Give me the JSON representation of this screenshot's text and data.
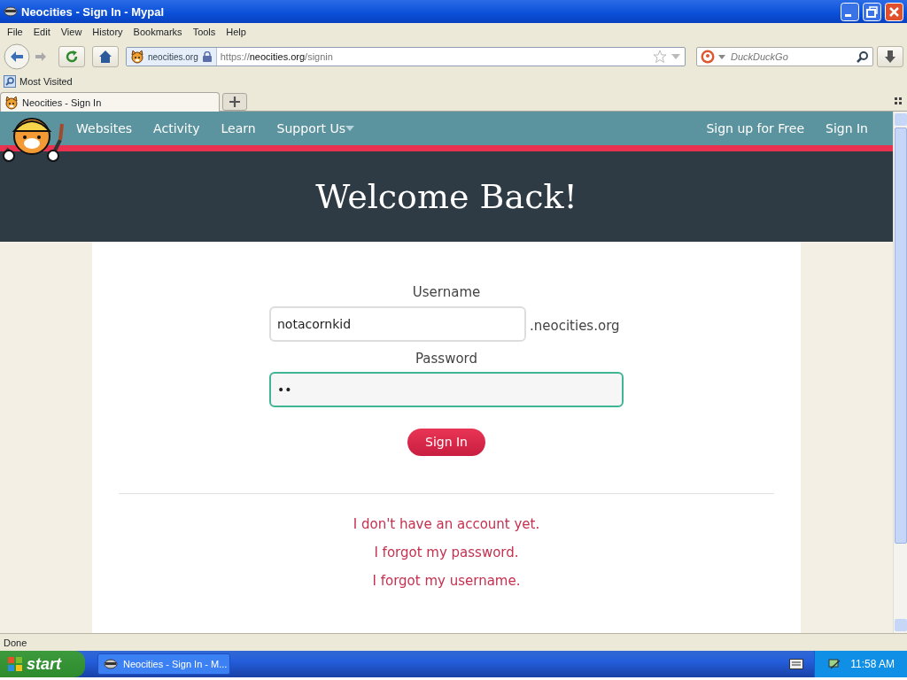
{
  "window": {
    "title": "Neocities - Sign In - Mypal"
  },
  "menu": [
    "File",
    "Edit",
    "View",
    "History",
    "Bookmarks",
    "Tools",
    "Help"
  ],
  "address_bar": {
    "identity": "neocities.org",
    "scheme": "https://",
    "host": "neocities.org",
    "path": "/signin"
  },
  "search": {
    "placeholder": "DuckDuckGo"
  },
  "bookmarks": [
    "Most Visited"
  ],
  "tabs": [
    {
      "label": "Neocities - Sign In",
      "selected": true
    }
  ],
  "site_nav": {
    "links": [
      {
        "label": "Websites",
        "dropdown": false
      },
      {
        "label": "Activity",
        "dropdown": false
      },
      {
        "label": "Learn",
        "dropdown": false
      },
      {
        "label": "Support Us",
        "dropdown": true
      }
    ],
    "right_links": [
      "Sign up for Free",
      "Sign In"
    ]
  },
  "heading": "Welcome Back!",
  "form": {
    "fields": [
      {
        "label": "Username",
        "value": "notacornkid",
        "suffix": ".neocities.org",
        "focused": false
      },
      {
        "label": "Password",
        "value": "••",
        "focused": true
      }
    ],
    "submit": "Sign In"
  },
  "links": [
    "I don't have an account yet.",
    "I forgot my password.",
    "I forgot my username."
  ],
  "status_bar": "Done",
  "taskbar": {
    "start": "start",
    "tasks": [
      "Neocities - Sign In - M..."
    ],
    "clock": "11:58 AM"
  }
}
